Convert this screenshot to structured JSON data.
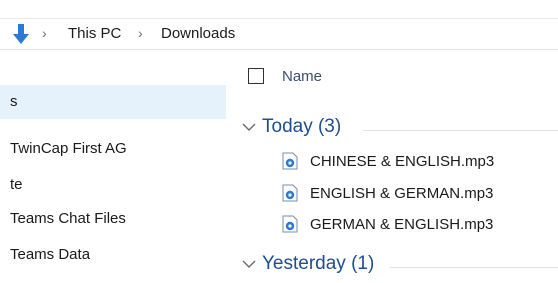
{
  "breadcrumb": {
    "items": [
      "This PC",
      "Downloads"
    ],
    "separator": "›"
  },
  "sidebar": {
    "items": [
      {
        "label": "s",
        "selected": true
      },
      {
        "label": "TwinCap First AG",
        "selected": false
      },
      {
        "label": "te",
        "selected": false
      },
      {
        "label": "Teams Chat Files",
        "selected": false
      },
      {
        "label": "Teams Data",
        "selected": false
      }
    ]
  },
  "columns": {
    "name": "Name"
  },
  "groups": [
    {
      "label": "Today (3)",
      "files": [
        {
          "name": "CHINESE & ENGLISH.mp3",
          "icon": "audio-file-icon"
        },
        {
          "name": "ENGLISH & GERMAN.mp3",
          "icon": "audio-file-icon"
        },
        {
          "name": "GERMAN & ENGLISH.mp3",
          "icon": "audio-file-icon"
        }
      ]
    },
    {
      "label": "Yesterday (1)",
      "files": []
    }
  ],
  "colors": {
    "accent": "#1e4d90",
    "selection": "#e5f1fb",
    "download_arrow": "#2b7bd6"
  }
}
